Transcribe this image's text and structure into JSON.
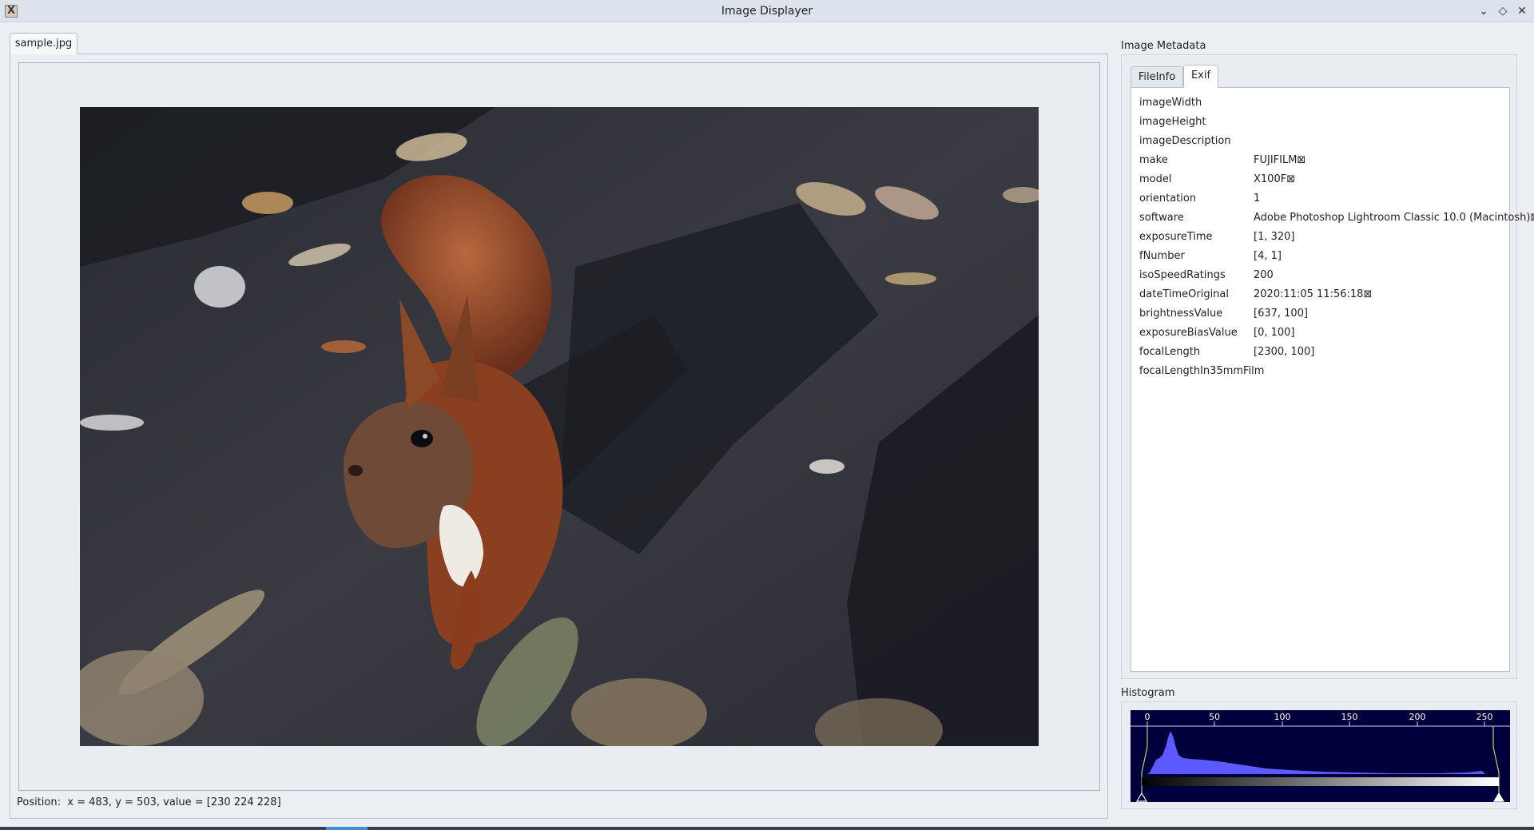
{
  "window": {
    "title": "Image Displayer"
  },
  "document": {
    "tab_label": "sample.jpg",
    "status": {
      "prefix": "Position:",
      "text": "x = 483, y = 503, value = [230 224 228]"
    }
  },
  "metadata": {
    "group_title": "Image Metadata",
    "tabs": [
      {
        "label": "FileInfo"
      },
      {
        "label": "Exif"
      }
    ],
    "active_tab": "Exif",
    "rows": [
      {
        "key": "imageWidth",
        "value": ""
      },
      {
        "key": "imageHeight",
        "value": ""
      },
      {
        "key": "imageDescription",
        "value": ""
      },
      {
        "key": "make",
        "value": "FUJIFILM⊠"
      },
      {
        "key": "model",
        "value": "X100F⊠"
      },
      {
        "key": "orientation",
        "value": "1"
      },
      {
        "key": "software",
        "value": "Adobe Photoshop Lightroom Classic 10.0 (Macintosh)⊠"
      },
      {
        "key": "exposureTime",
        "value": "[1, 320]"
      },
      {
        "key": "fNumber",
        "value": "[4, 1]"
      },
      {
        "key": "isoSpeedRatings",
        "value": "200"
      },
      {
        "key": "dateTimeOriginal",
        "value": "2020:11:05 11:56:18⊠"
      },
      {
        "key": "brightnessValue",
        "value": "[637, 100]"
      },
      {
        "key": "exposureBiasValue",
        "value": "[0, 100]"
      },
      {
        "key": "focalLength",
        "value": "[2300, 100]"
      },
      {
        "key": "focalLengthIn35mmFilm",
        "value": ""
      }
    ]
  },
  "histogram": {
    "title": "Histogram",
    "axis_labels": [
      "0",
      "50",
      "100",
      "150",
      "200",
      "250"
    ],
    "range_low": 0,
    "range_high": 255,
    "colors": {
      "background": "#00003c",
      "fill": "#5a5aff",
      "marker": "#c8c86e"
    }
  },
  "icons": {
    "app": "x-app-icon",
    "minimize": "chevron-down-icon",
    "maximize": "diamond-icon",
    "close": "close-icon"
  }
}
